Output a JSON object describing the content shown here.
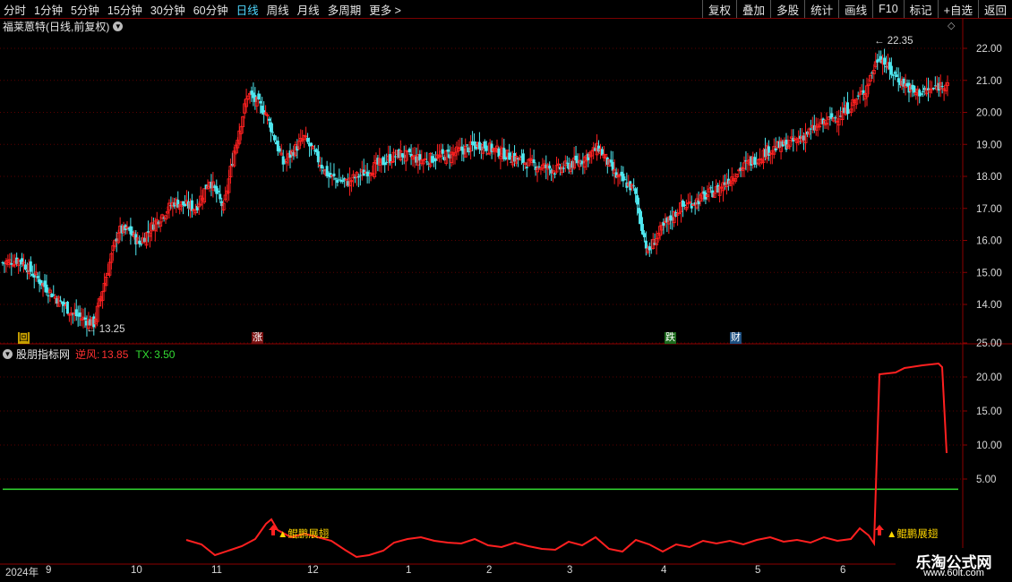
{
  "toolbar": {
    "periods": [
      "分时",
      "1分钟",
      "5分钟",
      "15分钟",
      "30分钟",
      "60分钟",
      "日线",
      "周线",
      "月线",
      "多周期",
      "更多 >"
    ],
    "active_period": "日线",
    "buttons": [
      "复权",
      "叠加",
      "多股",
      "统计",
      "画线",
      "F10",
      "标记",
      "+自选",
      "返回"
    ]
  },
  "main_panel": {
    "title": "福莱蒽特(日线,前复权)",
    "y_ticks": [
      "22.00",
      "21.00",
      "20.00",
      "19.00",
      "18.00",
      "17.00",
      "16.00",
      "15.00",
      "14.00"
    ],
    "high_label": "22.35",
    "low_label": "13.25",
    "tags": [
      {
        "text": "回",
        "bg": "#c8a000",
        "fg": "#000"
      },
      {
        "text": "涨",
        "bg": "#7a1010",
        "fg": "#fff"
      },
      {
        "text": "跌",
        "bg": "#1d6b1d",
        "fg": "#fff"
      },
      {
        "text": "财",
        "bg": "#1d4f80",
        "fg": "#fff"
      }
    ]
  },
  "indicator_panel": {
    "name": "股朋指标网",
    "series": [
      {
        "label": "逆风:",
        "value": "13.85",
        "color": "#ff3030"
      },
      {
        "label": "TX:",
        "value": "3.50",
        "color": "#33dd33"
      }
    ],
    "y_ticks": [
      "25.00",
      "20.00",
      "15.00",
      "10.00",
      "5.00"
    ],
    "signal_label": "▲鲲鹏展翅"
  },
  "x_axis": {
    "labels": [
      "2024年",
      "9",
      "10",
      "11",
      "12",
      "1",
      "2",
      "3",
      "4",
      "5",
      "6"
    ]
  },
  "watermark": {
    "line1": "乐淘公式网",
    "line2": "www.60lt.com"
  },
  "colors": {
    "up": "#ff2020",
    "down": "#4fe8f0",
    "tx": "#33dd33",
    "frame": "#8b0000"
  },
  "chart_data": {
    "type": "line",
    "series": [
      {
        "name": "逆风",
        "last": 13.85
      },
      {
        "name": "TX",
        "values_constant": 3.5
      }
    ],
    "ylim": [
      0,
      28
    ],
    "ylabel": "",
    "xlabel": ""
  }
}
